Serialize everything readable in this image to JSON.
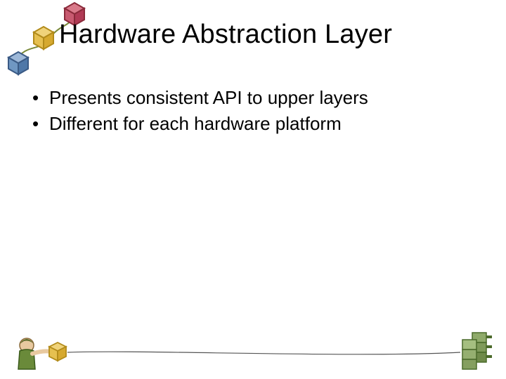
{
  "slide": {
    "title": "Hardware Abstraction Layer",
    "bullets": [
      "Presents consistent API to upper layers",
      "Different for each hardware platform"
    ],
    "bullet_glyph": "•"
  }
}
